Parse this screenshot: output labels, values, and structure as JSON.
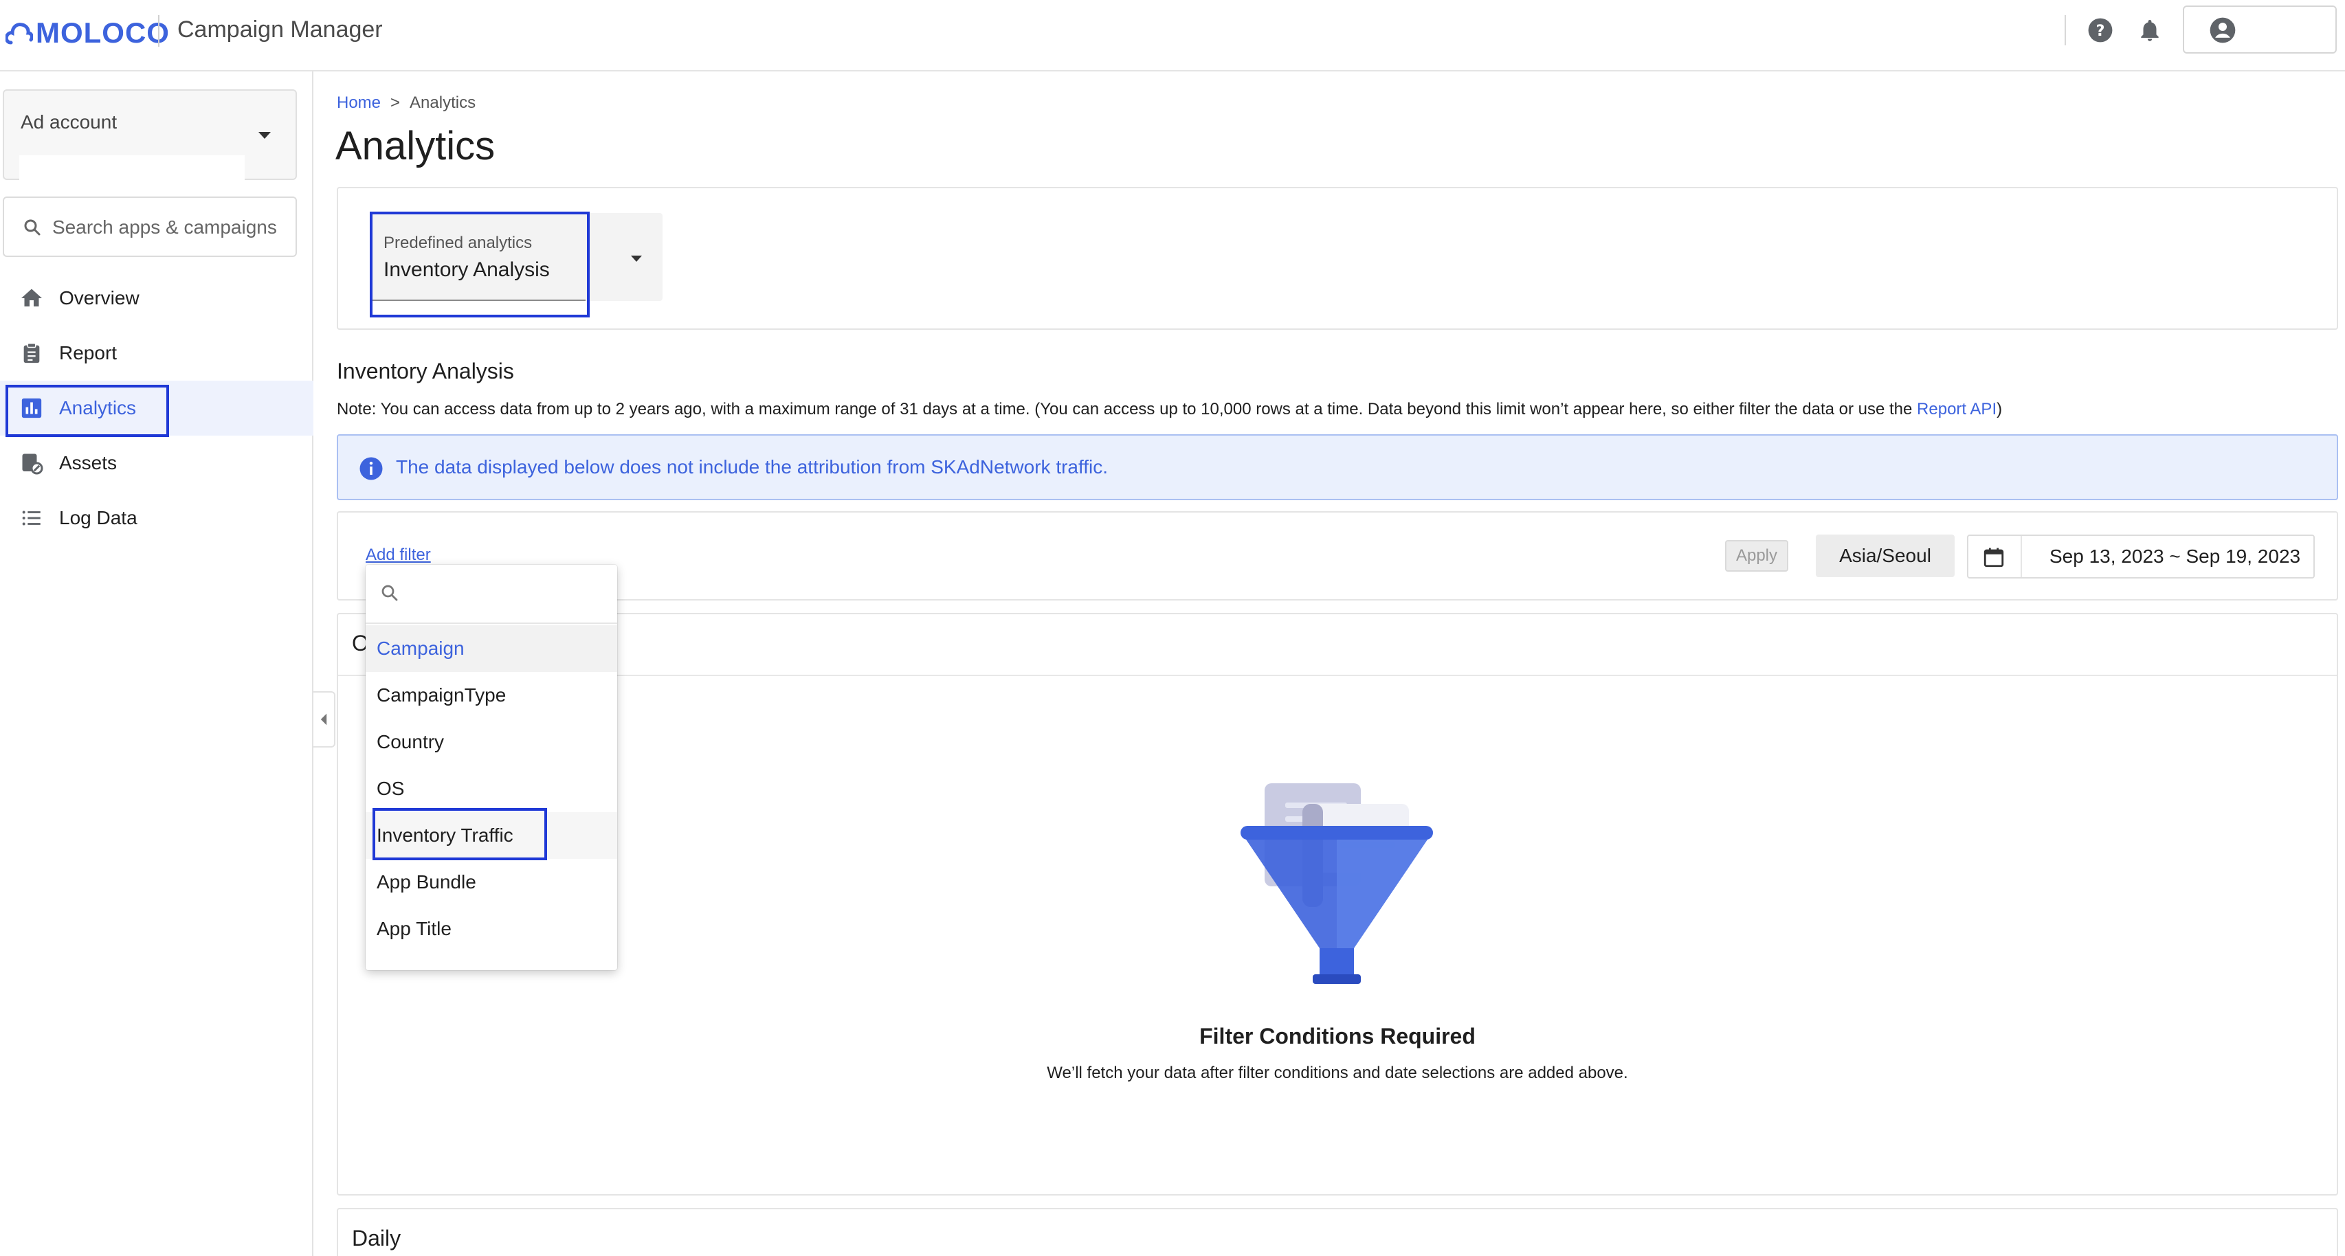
{
  "header": {
    "logo_text": "MOLOCO",
    "app_title": "Campaign Manager",
    "help_icon": "help-circle-icon",
    "bell_icon": "bell-icon",
    "account_icon": "account-circle-icon"
  },
  "sidebar": {
    "ad_account_label": "Ad account",
    "search_placeholder": "Search apps & campaigns",
    "items": [
      {
        "label": "Overview",
        "icon": "home-icon"
      },
      {
        "label": "Report",
        "icon": "clipboard-icon"
      },
      {
        "label": "Analytics",
        "icon": "bar-chart-icon",
        "active": true
      },
      {
        "label": "Assets",
        "icon": "assets-icon"
      },
      {
        "label": "Log Data",
        "icon": "list-icon"
      }
    ]
  },
  "breadcrumb": {
    "home": "Home",
    "separator": ">",
    "current": "Analytics"
  },
  "page": {
    "title": "Analytics",
    "predefined_label": "Predefined analytics",
    "predefined_value": "Inventory Analysis",
    "section_title": "Inventory Analysis",
    "note_text": "Note: You can access data from up to 2 years ago, with a maximum range of 31 days at a time. (You can access up to 10,000 rows at a time. Data beyond this limit won’t appear here, so either filter the data or use the ",
    "note_link": "Report API",
    "note_end": ")",
    "info_banner": "The data displayed below does not include the attribution from SKAdNetwork traffic."
  },
  "filters": {
    "add_filter": "Add filter",
    "apply": "Apply",
    "timezone": "Asia/Seoul",
    "date_range": "Sep 13, 2023 ~ Sep 19, 2023"
  },
  "dropdown": {
    "search_value": "",
    "options": [
      "Campaign",
      "CampaignType",
      "Country",
      "OS",
      "Inventory Traffic",
      "App Bundle",
      "App Title"
    ],
    "selected": "Campaign",
    "hovered": "Inventory Traffic"
  },
  "overview": {
    "title_visible": "O"
  },
  "empty_state": {
    "title": "Filter Conditions Required",
    "subtitle": "We’ll fetch your data after filter conditions and date selections are added above."
  },
  "daily": {
    "title": "Daily"
  },
  "colors": {
    "accent": "#3d63dd",
    "highlight_box": "#1f39d6",
    "banner_bg": "#eaf0fd"
  }
}
